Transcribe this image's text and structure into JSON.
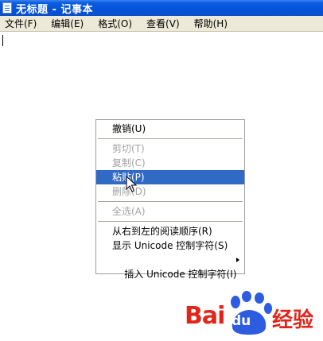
{
  "window": {
    "title": "无标题 - 记事本",
    "icon": "notepad-icon"
  },
  "menubar": {
    "items": [
      {
        "label": "文件(F)"
      },
      {
        "label": "编辑(E)"
      },
      {
        "label": "格式(O)"
      },
      {
        "label": "查看(V)"
      },
      {
        "label": "帮助(H)"
      }
    ]
  },
  "context_menu": {
    "items": [
      {
        "label": "撤销(U)",
        "state": "enabled"
      },
      {
        "label": "剪切(T)",
        "state": "disabled"
      },
      {
        "label": "复制(C)",
        "state": "disabled"
      },
      {
        "label": "粘贴(P)",
        "state": "selected"
      },
      {
        "label": "删除(D)",
        "state": "disabled"
      },
      {
        "label": "全选(A)",
        "state": "disabled"
      },
      {
        "label": "从右到左的阅读顺序(R)",
        "state": "enabled"
      },
      {
        "label": "显示 Unicode 控制字符(S)",
        "state": "enabled"
      },
      {
        "label": "插入 Unicode 控制字符(I)",
        "state": "enabled",
        "submenu": true
      }
    ],
    "selected_color": "#316ac5"
  },
  "watermark": {
    "brand_a": "Bai",
    "brand_b": "du",
    "brand_c": "经验",
    "brand_color": "#e1251b",
    "paw_color": "#2e5ce0"
  }
}
